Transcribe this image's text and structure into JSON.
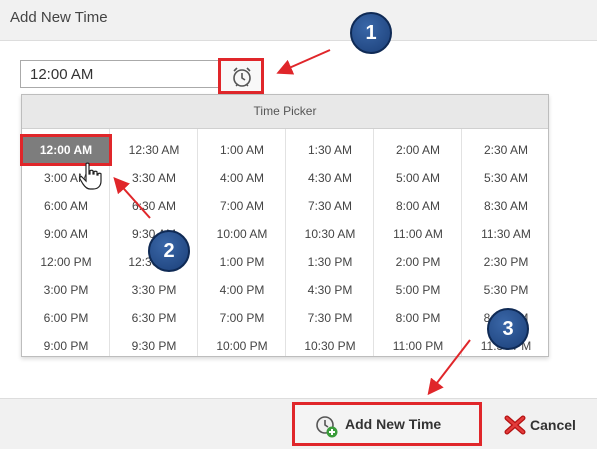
{
  "window": {
    "title": "Add New Time"
  },
  "time_input": {
    "value": "12:00 AM"
  },
  "time_picker": {
    "header": "Time Picker",
    "selected": "12:00 AM",
    "rows": [
      [
        "12:00 AM",
        "12:30 AM",
        "1:00 AM",
        "1:30 AM",
        "2:00 AM",
        "2:30 AM"
      ],
      [
        "3:00 AM",
        "3:30 AM",
        "4:00 AM",
        "4:30 AM",
        "5:00 AM",
        "5:30 AM"
      ],
      [
        "6:00 AM",
        "6:30 AM",
        "7:00 AM",
        "7:30 AM",
        "8:00 AM",
        "8:30 AM"
      ],
      [
        "9:00 AM",
        "9:30 AM",
        "10:00 AM",
        "10:30 AM",
        "11:00 AM",
        "11:30 AM"
      ],
      [
        "12:00 PM",
        "12:30 PM",
        "1:00 PM",
        "1:30 PM",
        "2:00 PM",
        "2:30 PM"
      ],
      [
        "3:00 PM",
        "3:30 PM",
        "4:00 PM",
        "4:30 PM",
        "5:00 PM",
        "5:30 PM"
      ],
      [
        "6:00 PM",
        "6:30 PM",
        "7:00 PM",
        "7:30 PM",
        "8:00 PM",
        "8:30 PM"
      ],
      [
        "9:00 PM",
        "9:30 PM",
        "10:00 PM",
        "10:30 PM",
        "11:00 PM",
        "11:30 PM"
      ]
    ]
  },
  "footer": {
    "add_label": "Add New Time",
    "cancel_label": "Cancel"
  },
  "annotations": {
    "step1": "1",
    "step2": "2",
    "step3": "3",
    "highlight_color": "#e0262a",
    "badge_color": "#1b3f78"
  },
  "icons": {
    "clock": "alarm-clock-icon",
    "add": "add-time-icon",
    "cancel": "red-x-icon",
    "cursor": "hand-pointer-icon"
  }
}
